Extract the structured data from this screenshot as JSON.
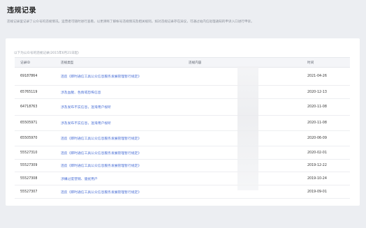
{
  "page": {
    "title": "违规记录",
    "description": "违规记录里记录了公众号的违规情况。运营者可随时进行查看，以更清晰了解帐号违规情况及相关规则。如对违规记录存在异议，可通过站内信处理通知的申诉入口进行申诉。"
  },
  "records": {
    "caption": "以下为公众号的违规记录(2015年6月21日起)",
    "columns": {
      "id": "记录ID",
      "type": "违规类型",
      "content": "违规内容",
      "time": "时间"
    },
    "rows": [
      {
        "id": "69187864",
        "type": "违反《即时通信工具公众信息服务发展管理暂行规定》",
        "time": "2021-04-26"
      },
      {
        "id": "65765119",
        "type": "涉及血腥、色情或恐怖信息",
        "time": "2020-12-13"
      },
      {
        "id": "64718763",
        "type": "涉及发布不实信息，混淆用户视听",
        "time": "2020-11-08"
      },
      {
        "id": "65505971",
        "type": "涉及发布不实信息，混淆用户视听",
        "time": "2020-11-08"
      },
      {
        "id": "65505970",
        "type": "违反《即时通信工具公众信息服务发展管理暂行规定》",
        "time": "2020-06-09"
      },
      {
        "id": "55527310",
        "type": "违反《即时通信工具公众信息服务发展管理暂行规定》",
        "time": "2020-02-01"
      },
      {
        "id": "55527309",
        "type": "违反《即时通信工具公众信息服务发展管理暂行规定》",
        "time": "2019-12-22"
      },
      {
        "id": "55527308",
        "type": "涉嫌过度营销、骚扰用户",
        "time": "2019-10-24"
      },
      {
        "id": "55527307",
        "type": "违反《即时通信工具公众信息服务发展管理暂行规定》",
        "time": "2019-09-01"
      }
    ]
  }
}
